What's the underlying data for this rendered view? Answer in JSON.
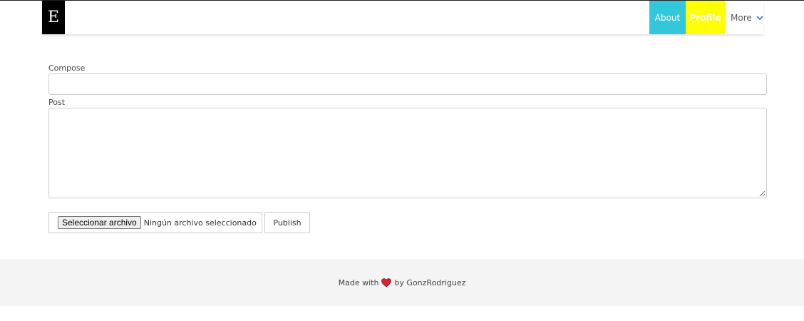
{
  "navbar": {
    "brand": "E",
    "items": [
      {
        "label": "About",
        "color": "#33c7dc"
      },
      {
        "label": "Profile",
        "color": "#ffff00"
      }
    ],
    "more_label": "More",
    "more_icon": "chevron-down-icon",
    "accent": "#3a7bd5"
  },
  "form": {
    "compose_label": "Compose",
    "compose_value": "",
    "post_label": "Post",
    "post_value": "",
    "file_button_label": "Seleccionar archivo",
    "file_status": "Ningún archivo seleccionado",
    "publish_label": "Publish"
  },
  "footer": {
    "text_before": "Made with",
    "icon": "heart-icon",
    "heart_color": "#e0202e",
    "text_after": "by GonzRodriguez"
  }
}
